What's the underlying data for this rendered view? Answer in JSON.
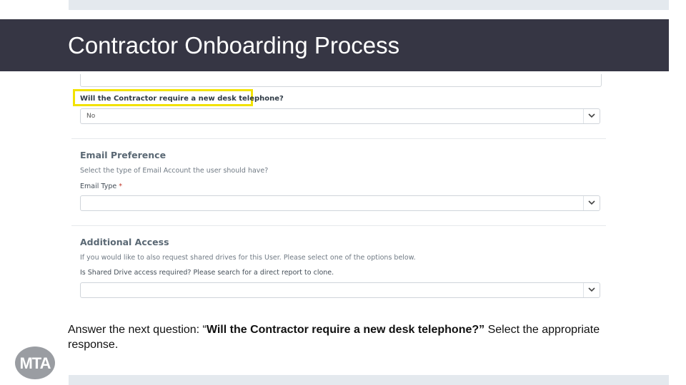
{
  "slide": {
    "title": "Contractor Onboarding Process",
    "instruction_prefix": "Answer the next question: “",
    "instruction_question": "Will the Contractor require a new desk telephone?”",
    "instruction_suffix": " Select the appropriate response."
  },
  "form": {
    "desk_phone": {
      "label": "Will the Contractor require a new desk telephone?",
      "value": "No"
    },
    "email_preference": {
      "title": "Email Preference",
      "help": "Select the type of Email Account the user should have?",
      "field_label": "Email Type",
      "required_mark": "*",
      "value": ""
    },
    "additional_access": {
      "title": "Additional Access",
      "help": "If you would like to also request shared drives for this User. Please select one of the options below.",
      "field_label": "Is Shared Drive access required? Please search for a direct report to clone.",
      "value": ""
    }
  },
  "logo": {
    "text": "MTA"
  },
  "colors": {
    "title_bar": "#363644",
    "highlight": "#f2e200",
    "strip": "#e4e9ee"
  }
}
